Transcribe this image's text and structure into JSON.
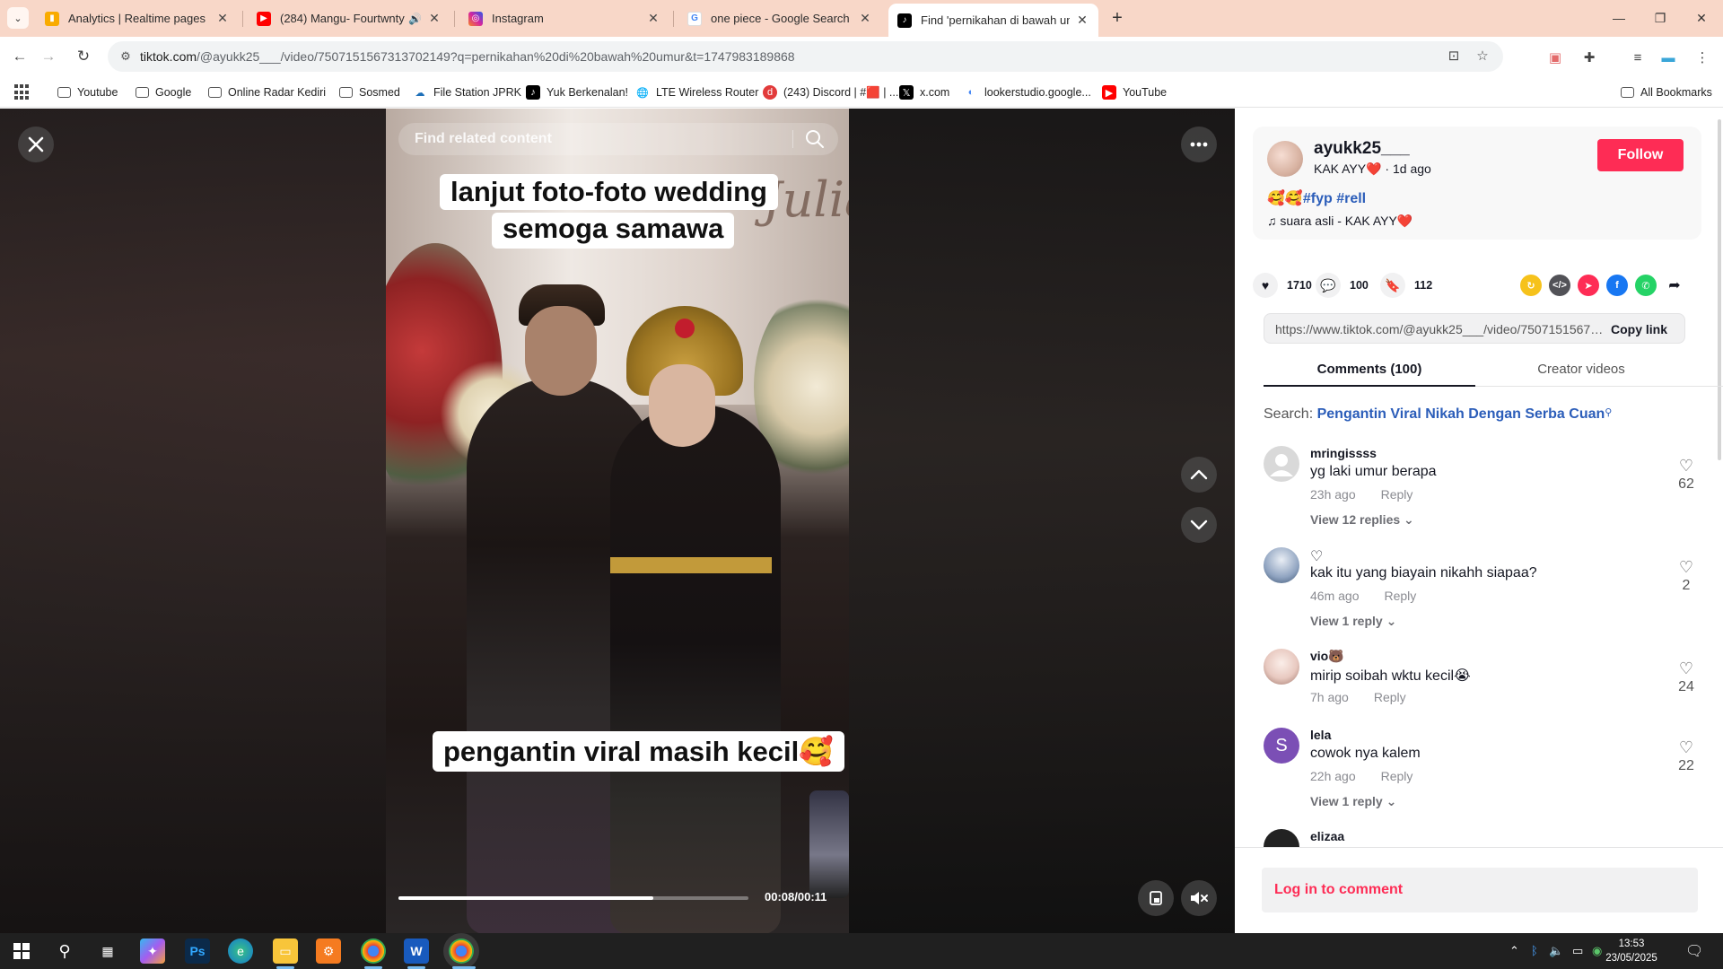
{
  "browser": {
    "tabs": [
      {
        "title": "Analytics | Realtime pages",
        "icon": "analytics-icon",
        "color": "#f9ab00"
      },
      {
        "title": "(284) Mangu- Fourtwnty || ",
        "icon": "youtube-icon",
        "color": "#ff0000",
        "audio": true
      },
      {
        "title": "Instagram",
        "icon": "instagram-icon",
        "color": "#d6249f"
      },
      {
        "title": "one piece - Google Search",
        "icon": "google-icon",
        "color": "#4285f4"
      },
      {
        "title": "Find 'pernikahan di bawah umu",
        "icon": "tiktok-icon",
        "color": "#000000",
        "active": true
      }
    ],
    "new_tab_glyph": "+",
    "url_host": "tiktok.com",
    "url_path": "/@ayukk25___/video/7507151567313702149?q=pernikahan%20di%20bawah%20umur&t=1747983189868"
  },
  "bookmarks": [
    {
      "label": "Youtube",
      "icon": "folder-icon"
    },
    {
      "label": "Google",
      "icon": "folder-icon"
    },
    {
      "label": "Online Radar Kediri",
      "icon": "folder-icon"
    },
    {
      "label": "Sosmed",
      "icon": "folder-icon"
    },
    {
      "label": "File Station JPRK",
      "icon": "cloud-icon"
    },
    {
      "label": "Yuk Berkenalan!",
      "icon": "tiktok-icon"
    },
    {
      "label": "LTE Wireless Router",
      "icon": "globe-icon"
    },
    {
      "label": "(243) Discord | #🟥 | ...",
      "icon": "discord-icon"
    },
    {
      "label": "x.com",
      "icon": "x-icon"
    },
    {
      "label": "lookerstudio.google...",
      "icon": "looker-icon"
    },
    {
      "label": "YouTube",
      "icon": "youtube-icon"
    }
  ],
  "all_bookmarks": "All Bookmarks",
  "video": {
    "search_placeholder": "Find related content",
    "caption_top_1": "lanjut foto-foto wedding",
    "caption_top_2": "semoga samawa",
    "caption_bottom": "pengantin viral masih kecil🥰",
    "script_text": "Julia",
    "time": "00:08/00:11",
    "progress": 0.727
  },
  "post": {
    "author": "ayukk25___",
    "display_name": "KAK AYY❤️",
    "posted": "1d ago",
    "follow_label": "Follow",
    "caption_emoji": "🥰🥰",
    "hashtags": [
      "#fyp",
      "#rell"
    ],
    "music": "suara asli - KAK AYY❤️",
    "likes": "1710",
    "comments": "100",
    "saves": "112",
    "link": "https://www.tiktok.com/@ayukk25___/video/7507151567313702149",
    "copy_label": "Copy link",
    "tab_comments": "Comments (100)",
    "tab_creator": "Creator videos",
    "search_prefix": "Search:",
    "search_query": "Pengantin Viral Nikah Dengan Serba Cuan",
    "login_prompt": "Log in to comment"
  },
  "comments": [
    {
      "user": "mringissss",
      "text": "yg laki umur berapa",
      "time": "23h ago",
      "reply": "Reply",
      "likes": "62",
      "replies": "View 12 replies",
      "avatar_color": "#d9d9d9"
    },
    {
      "user": "♡",
      "text": "kak itu yang biayain nikahh siapaa?",
      "time": "46m ago",
      "reply": "Reply",
      "likes": "2",
      "replies": "View 1 reply",
      "avatar_color": "#8fa3c0"
    },
    {
      "user": "vio🐻",
      "text": "mirip soibah wktu kecil😭",
      "time": "7h ago",
      "reply": "Reply",
      "likes": "24",
      "replies": "",
      "avatar_color": "#e8c9c0"
    },
    {
      "user": "lela",
      "text": "cowok nya kalem",
      "time": "22h ago",
      "reply": "Reply",
      "likes": "22",
      "replies": "View 1 reply",
      "avatar_color": "#7b4fb5",
      "initial": "S"
    },
    {
      "user": "elizaa",
      "text": "",
      "time": "",
      "reply": "",
      "likes": "",
      "replies": "",
      "avatar_color": "#222222"
    }
  ],
  "taskbar": {
    "time": "13:53",
    "date": "23/05/2025"
  }
}
